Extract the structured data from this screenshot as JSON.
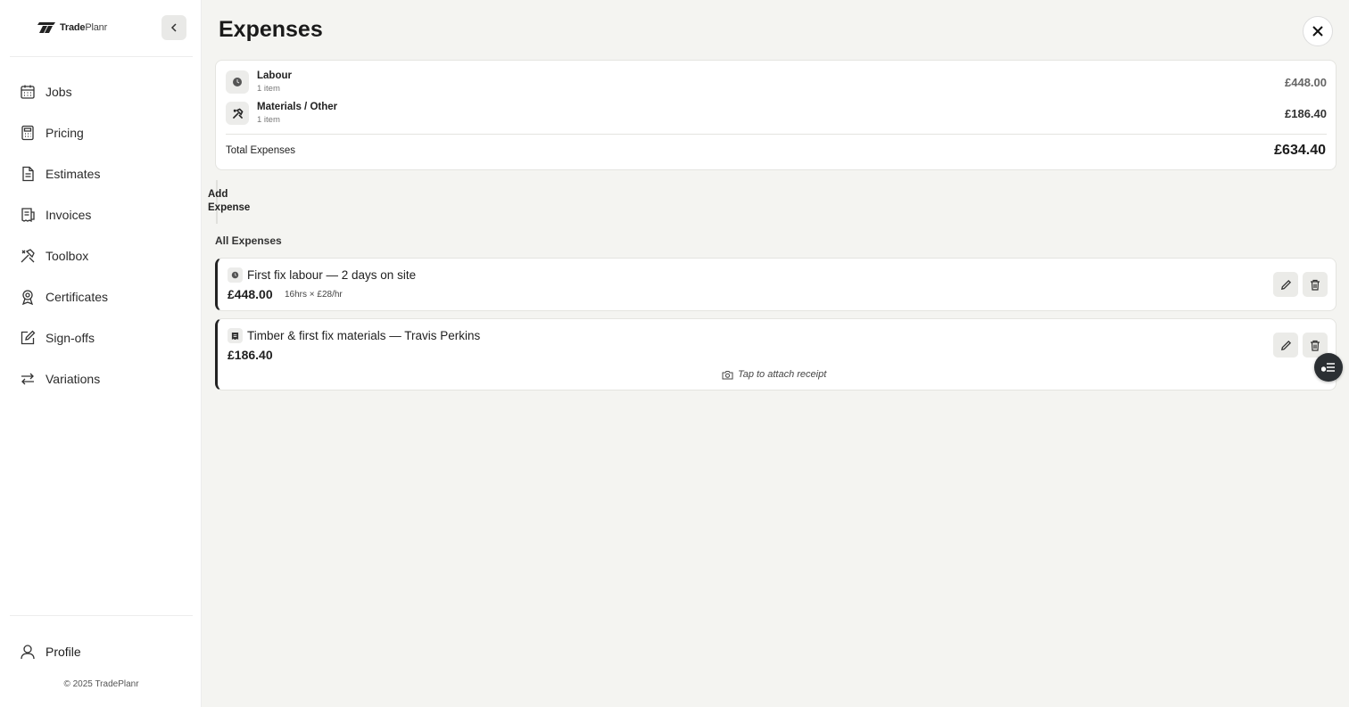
{
  "brand": {
    "name_bold": "Trade",
    "name_light": "Planr"
  },
  "sidebar": {
    "items": [
      {
        "label": "Jobs",
        "icon": "calendar-icon"
      },
      {
        "label": "Pricing",
        "icon": "calculator-icon"
      },
      {
        "label": "Estimates",
        "icon": "document-icon"
      },
      {
        "label": "Invoices",
        "icon": "invoice-icon"
      },
      {
        "label": "Toolbox",
        "icon": "tools-icon"
      },
      {
        "label": "Certificates",
        "icon": "award-icon"
      },
      {
        "label": "Sign-offs",
        "icon": "edit-square-icon"
      },
      {
        "label": "Variations",
        "icon": "swap-arrows-icon"
      }
    ],
    "profile_label": "Profile",
    "copyright": "© 2025 TradePlanr"
  },
  "page": {
    "title": "Expenses"
  },
  "summary": {
    "rows": [
      {
        "label": "Labour",
        "count": "1 item",
        "amount": "£448.00",
        "icon": "clock-icon"
      },
      {
        "label": "Materials / Other",
        "count": "1 item",
        "amount": "£186.40",
        "icon": "tools-icon"
      }
    ],
    "total_label": "Total Expenses",
    "total_amount": "£634.40"
  },
  "add_expense_label": "Add Expense",
  "list": {
    "title": "All Expenses",
    "items": [
      {
        "title": "First fix labour — 2 days on site",
        "amount": "£448.00",
        "detail": "16hrs × £28/hr",
        "icon": "clock-icon"
      },
      {
        "title": "Timber & first fix materials — Travis Perkins",
        "amount": "£186.40",
        "detail": "",
        "icon": "receipt-icon",
        "receipt_label": "Tap to attach receipt"
      }
    ]
  },
  "colors": {
    "accent": "#222222",
    "background": "#f4f4f1",
    "card": "#ffffff"
  }
}
